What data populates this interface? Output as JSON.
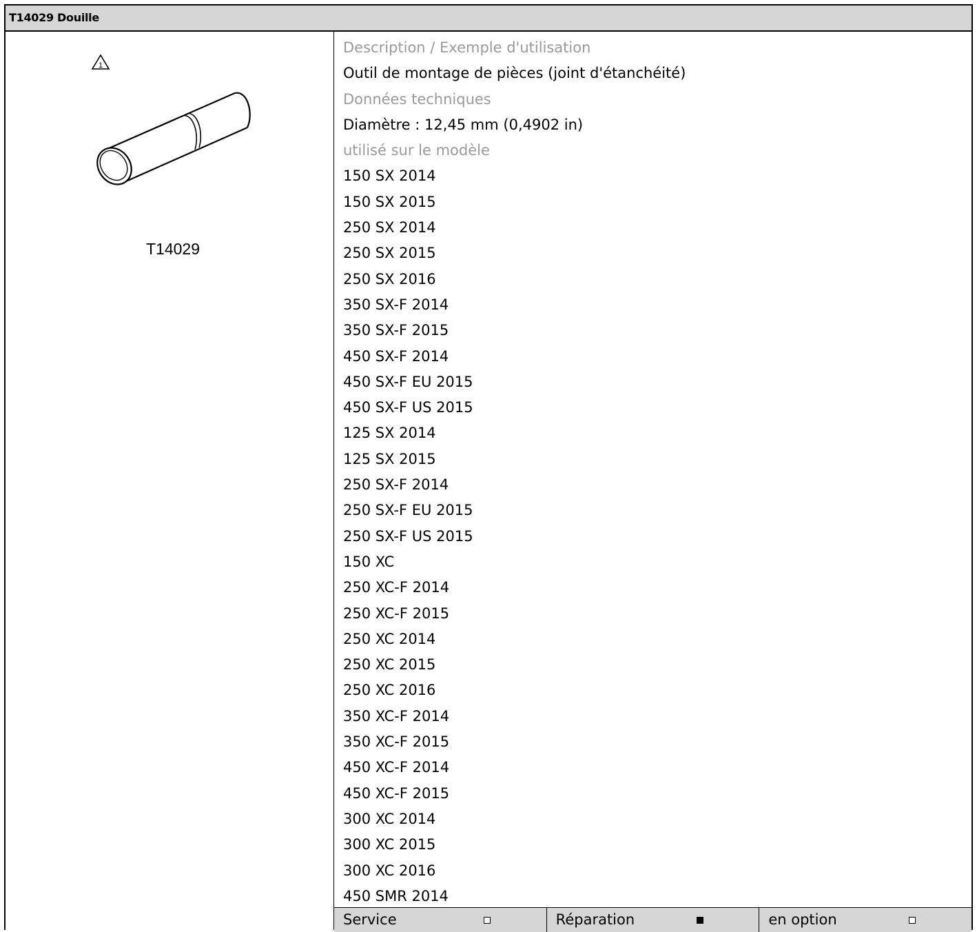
{
  "header": {
    "title": "T14029 Douille"
  },
  "figure": {
    "label": "T14029",
    "warning_number": "1"
  },
  "details": {
    "description_caption": "Description / Exemple d'utilisation",
    "description": "Outil de montage de pièces (joint d'étanchéité)",
    "tech_caption": "Données techniques",
    "tech_value": "Diamètre : 12,45 mm (0,4902 in)",
    "models_caption": "utilisé sur le modèle",
    "models": [
      "150 SX 2014",
      "150 SX 2015",
      "250 SX 2014",
      "250 SX 2015",
      "250 SX 2016",
      "350 SX-F 2014",
      "350 SX-F 2015",
      "450 SX-F 2014",
      "450 SX-F EU 2015",
      "450 SX-F US 2015",
      "125 SX 2014",
      "125 SX 2015",
      "250 SX-F 2014",
      "250 SX-F EU 2015",
      "250 SX-F US 2015",
      "150 XC",
      "250 XC-F 2014",
      "250 XC-F 2015",
      "250 XC 2014",
      "250 XC 2015",
      "250 XC 2016",
      "350 XC-F 2014",
      "350 XC-F 2015",
      "450 XC-F 2014",
      "450 XC-F 2015",
      "300 XC 2014",
      "300 XC 2015",
      "300 XC 2016",
      "450 SMR 2014"
    ]
  },
  "footer": {
    "items": [
      {
        "label": "Service",
        "checked": false
      },
      {
        "label": "Réparation",
        "checked": true
      },
      {
        "label": "en option",
        "checked": false
      }
    ]
  }
}
